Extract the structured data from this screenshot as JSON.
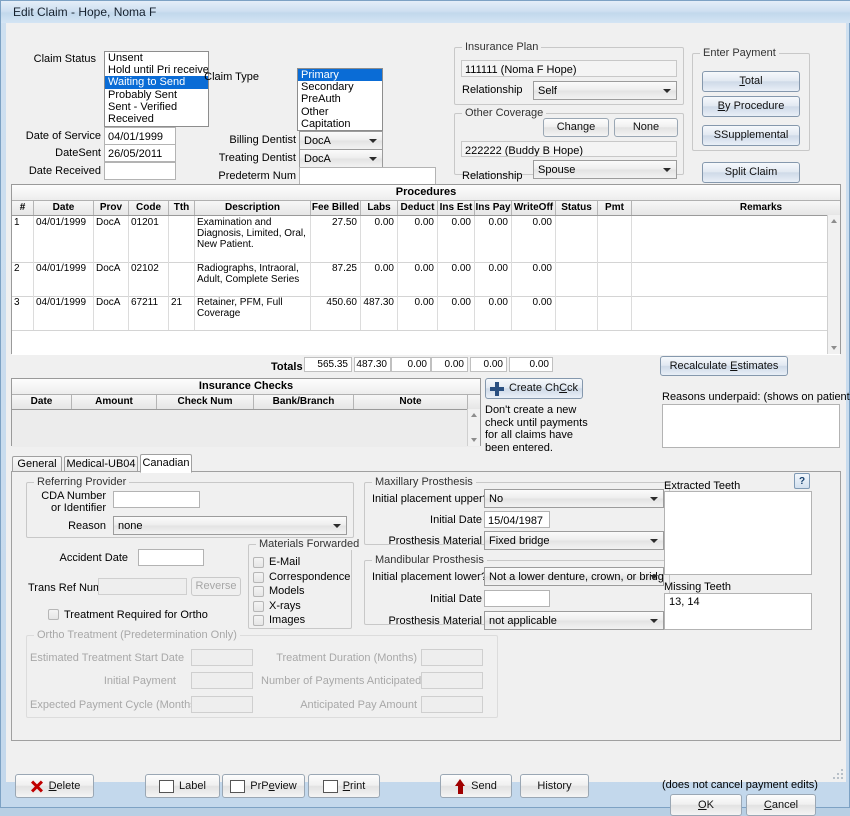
{
  "window": {
    "title": "Edit Claim - Hope, Noma F"
  },
  "claim": {
    "status_label": "Claim Status",
    "status_options": [
      "Unsent",
      "Hold until Pri received",
      "Waiting to Send",
      "Probably Sent",
      "Sent - Verified",
      "Received"
    ],
    "status_selected_index": 2,
    "type_label": "Claim Type",
    "type_options": [
      "Primary",
      "Secondary",
      "PreAuth",
      "Other",
      "Capitation"
    ],
    "type_selected_index": 0,
    "date_of_service_label": "Date of Service",
    "date_of_service": "04/01/1999",
    "date_sent_label": "DateSent",
    "date_sent": "26/05/2011",
    "date_received_label": "Date Received",
    "date_received": "",
    "billing_dentist_label": "Billing Dentist",
    "billing_dentist": "DocA",
    "treating_dentist_label": "Treating Dentist",
    "treating_dentist": "DocA",
    "predeterm_label": "Predeterm Num",
    "predeterm_num": ""
  },
  "insurance_plan": {
    "caption": "Insurance Plan",
    "plan": "111111 (Noma F Hope)",
    "relationship_label": "Relationship",
    "relationship": "Self"
  },
  "other_coverage": {
    "caption": "Other Coverage",
    "change_label": "Change",
    "none_label": "None",
    "plan": "222222 (Buddy B Hope)",
    "relationship_label": "Relationship",
    "relationship": "Spouse"
  },
  "enter_payment": {
    "caption": "Enter Payment",
    "total_label": "Total",
    "total_accel": "T",
    "by_procedure_label": "By Procedure",
    "by_procedure_accel": "B",
    "supplemental_label": "Supplemental",
    "supplemental_accel": "S",
    "split_claim_label": "Split Claim"
  },
  "procedures": {
    "title": "Procedures",
    "columns": [
      "#",
      "Date",
      "Prov",
      "Code",
      "Tth",
      "Description",
      "Fee Billed",
      "Labs",
      "Deduct",
      "Ins Est",
      "Ins Pay",
      "WriteOff",
      "Status",
      "Pmt",
      "Remarks"
    ],
    "rows": [
      {
        "num": "1",
        "date": "04/01/1999",
        "prov": "DocA",
        "code": "01201",
        "tth": "",
        "description": "Examination and Diagnosis, Limited, Oral, New Patient.",
        "fee": "27.50",
        "labs": "0.00",
        "deduct": "0.00",
        "insest": "0.00",
        "inspay": "0.00",
        "writeoff": "0.00",
        "status": "",
        "pmt": "",
        "remarks": ""
      },
      {
        "num": "2",
        "date": "04/01/1999",
        "prov": "DocA",
        "code": "02102",
        "tth": "",
        "description": "Radiographs, Intraoral, Adult, Complete Series",
        "fee": "87.25",
        "labs": "0.00",
        "deduct": "0.00",
        "insest": "0.00",
        "inspay": "0.00",
        "writeoff": "0.00",
        "status": "",
        "pmt": "",
        "remarks": ""
      },
      {
        "num": "3",
        "date": "04/01/1999",
        "prov": "DocA",
        "code": "67211",
        "tth": "21",
        "description": "Retainer, PFM, Full Coverage",
        "fee": "450.60",
        "labs": "487.30",
        "deduct": "0.00",
        "insest": "0.00",
        "inspay": "0.00",
        "writeoff": "0.00",
        "status": "",
        "pmt": "",
        "remarks": ""
      }
    ],
    "totals_label": "Totals",
    "totals": [
      "565.35",
      "487.30",
      "0.00",
      "0.00",
      "0.00",
      "0.00"
    ]
  },
  "recalculate_label": "Recalculate Estimates",
  "recalculate_accel": "E",
  "insurance_checks": {
    "title": "Insurance Checks",
    "columns": [
      "Date",
      "Amount",
      "Check Num",
      "Bank/Branch",
      "Note"
    ],
    "rows": []
  },
  "create_check": {
    "label": "Create Check",
    "accel": "C",
    "hint": "Don't create a new check until payments for all claims have been entered."
  },
  "reasons_underpaid": {
    "label": "Reasons underpaid:  (shows on patient bill)",
    "value": ""
  },
  "tabs": [
    {
      "label": "General",
      "active": false
    },
    {
      "label": "Medical-UB04",
      "active": false
    },
    {
      "label": "Canadian",
      "active": true
    }
  ],
  "canadian": {
    "referring_provider": {
      "caption": "Referring Provider",
      "cda_label_line1": "CDA Number",
      "cda_label_line2": "or Identifier",
      "cda_value": "",
      "reason_label": "Reason",
      "reason_value": "none"
    },
    "accident_date_label": "Accident Date",
    "accident_date": "",
    "trans_ref_label": "Trans Ref Num",
    "trans_ref_value": "",
    "reverse_label": "Reverse",
    "ortho_required_label": "Treatment Required for Ortho",
    "materials": {
      "caption": "Materials Forwarded",
      "items": [
        {
          "label": "E-Mail",
          "checked": false
        },
        {
          "label": "Correspondence",
          "checked": false
        },
        {
          "label": "Models",
          "checked": false
        },
        {
          "label": "X-rays",
          "checked": false
        },
        {
          "label": "Images",
          "checked": false
        }
      ]
    },
    "maxillary": {
      "caption": "Maxillary Prosthesis",
      "initial_placement_label": "Initial placement upper?",
      "initial_placement_value": "No",
      "initial_date_label": "Initial Date",
      "initial_date_value": "15/04/1987",
      "material_label": "Prosthesis Material",
      "material_value": "Fixed bridge"
    },
    "mandibular": {
      "caption": "Mandibular Prosthesis",
      "initial_placement_label": "Initial placement lower?",
      "initial_placement_value": "Not a lower denture, crown, or bridge",
      "initial_date_label": "Initial Date",
      "initial_date_value": "",
      "material_label": "Prosthesis Material",
      "material_value": "not applicable"
    },
    "extracted_teeth": {
      "label": "Extracted Teeth",
      "value": "",
      "help": "?"
    },
    "missing_teeth": {
      "label": "Missing Teeth",
      "value": "13, 14"
    },
    "ortho": {
      "caption": "Ortho Treatment (Predetermination Only)",
      "fields": [
        {
          "label": "Estimated Treatment Start Date",
          "value": ""
        },
        {
          "label": "Initial Payment",
          "value": ""
        },
        {
          "label": "Expected Payment Cycle (Months)",
          "value": ""
        },
        {
          "label": "Treatment Duration (Months)",
          "value": ""
        },
        {
          "label": "Number of Payments Anticipated",
          "value": ""
        },
        {
          "label": "Anticipated Pay Amount",
          "value": ""
        }
      ]
    }
  },
  "footer": {
    "delete_label": "Delete",
    "delete_accel": "D",
    "label_label": "Label",
    "preview_label": "Preview",
    "preview_accel": "P",
    "print_label": "Print",
    "print_accel": "P",
    "send_label": "Send",
    "history_label": "History",
    "ok_label": "OK",
    "ok_accel": "O",
    "cancel_label": "Cancel",
    "cancel_accel": "C",
    "hint": "(does not cancel payment edits)"
  },
  "colors": {
    "selection_blue": "#0a6cd6",
    "title_gradient_top": "#e4eef8",
    "window_border": "#7da2c4",
    "delete_red": "#c00000",
    "send_arrow_red": "#a00000"
  }
}
